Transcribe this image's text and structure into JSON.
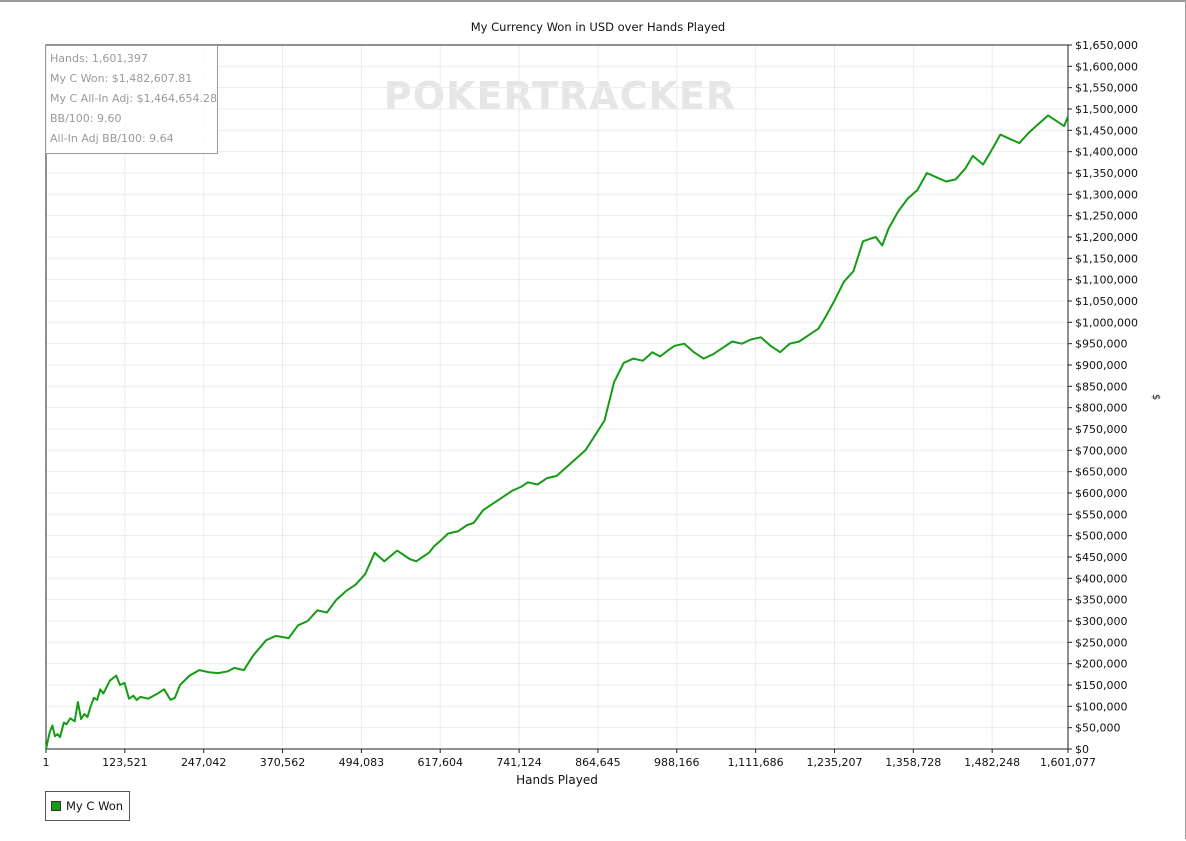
{
  "chart_data": {
    "type": "line",
    "title": "My Currency Won in USD over Hands Played",
    "xlabel": "Hands Played",
    "ylabel": "$",
    "watermark": "POKERTRACKER",
    "xlim": [
      1,
      1601077
    ],
    "ylim": [
      0,
      1650000
    ],
    "x_ticks": [
      1,
      123521,
      247042,
      370562,
      494083,
      617604,
      741124,
      864645,
      988166,
      1111686,
      1235207,
      1358728,
      1482248,
      1601077
    ],
    "x_tick_labels": [
      "1",
      "123,521",
      "247,042",
      "370,562",
      "494,083",
      "617,604",
      "741,124",
      "864,645",
      "988,166",
      "1,111,686",
      "1,235,207",
      "1,358,728",
      "1,482,248",
      "1,601,077"
    ],
    "y_ticks": [
      0,
      50000,
      100000,
      150000,
      200000,
      250000,
      300000,
      350000,
      400000,
      450000,
      500000,
      550000,
      600000,
      650000,
      700000,
      750000,
      800000,
      850000,
      900000,
      950000,
      1000000,
      1050000,
      1100000,
      1150000,
      1200000,
      1250000,
      1300000,
      1350000,
      1400000,
      1450000,
      1500000,
      1550000,
      1600000,
      1650000
    ],
    "y_tick_labels": [
      "$0",
      "$50,000",
      "$100,000",
      "$150,000",
      "$200,000",
      "$250,000",
      "$300,000",
      "$350,000",
      "$400,000",
      "$450,000",
      "$500,000",
      "$550,000",
      "$600,000",
      "$650,000",
      "$700,000",
      "$750,000",
      "$800,000",
      "$850,000",
      "$900,000",
      "$950,000",
      "$1,000,000",
      "$1,050,000",
      "$1,100,000",
      "$1,150,000",
      "$1,200,000",
      "$1,250,000",
      "$1,300,000",
      "$1,350,000",
      "$1,400,000",
      "$1,450,000",
      "$1,500,000",
      "$1,550,000",
      "$1,600,000",
      "$1,650,000"
    ],
    "grid": true,
    "legend_position": "bottom-left",
    "series": [
      {
        "name": "My C Won",
        "color": "#159c15",
        "x": [
          1,
          6000,
          10000,
          14000,
          18000,
          22000,
          28000,
          32000,
          38000,
          45000,
          50000,
          55000,
          60000,
          65000,
          70000,
          75000,
          80000,
          85000,
          90000,
          100000,
          110000,
          116000,
          123000,
          130000,
          137000,
          142000,
          148000,
          160000,
          175000,
          185000,
          195000,
          202000,
          210000,
          225000,
          240000,
          255000,
          270000,
          285000,
          295000,
          310000,
          325000,
          345000,
          360000,
          380000,
          395000,
          410000,
          425000,
          440000,
          455000,
          470000,
          485000,
          500000,
          515000,
          530000,
          550000,
          565000,
          570000,
          580000,
          590000,
          600000,
          608000,
          618000,
          630000,
          645000,
          660000,
          670000,
          685000,
          700000,
          715000,
          730000,
          745000,
          755000,
          770000,
          785000,
          800000,
          815000,
          830000,
          845000,
          860000,
          875000,
          890000,
          905000,
          920000,
          935000,
          950000,
          962000,
          975000,
          985000,
          1000000,
          1015000,
          1030000,
          1045000,
          1060000,
          1075000,
          1090000,
          1105000,
          1120000,
          1135000,
          1150000,
          1165000,
          1180000,
          1195000,
          1210000,
          1220000,
          1235000,
          1250000,
          1265000,
          1280000,
          1290000,
          1300000,
          1310000,
          1320000,
          1335000,
          1350000,
          1365000,
          1380000,
          1395000,
          1410000,
          1425000,
          1440000,
          1452000,
          1468000,
          1480000,
          1495000,
          1510000,
          1525000,
          1540000,
          1555000,
          1570000,
          1585000,
          1595000,
          1601077
        ],
        "y": [
          0,
          40000,
          55000,
          30000,
          35000,
          28000,
          62000,
          58000,
          72000,
          65000,
          110000,
          70000,
          82000,
          75000,
          100000,
          120000,
          115000,
          140000,
          130000,
          160000,
          172000,
          150000,
          155000,
          118000,
          125000,
          115000,
          122000,
          118000,
          130000,
          140000,
          115000,
          120000,
          150000,
          172000,
          185000,
          180000,
          178000,
          182000,
          190000,
          185000,
          220000,
          255000,
          265000,
          260000,
          290000,
          300000,
          325000,
          320000,
          350000,
          370000,
          385000,
          410000,
          460000,
          440000,
          465000,
          450000,
          445000,
          440000,
          450000,
          460000,
          475000,
          488000,
          505000,
          510000,
          525000,
          530000,
          560000,
          575000,
          590000,
          605000,
          615000,
          625000,
          620000,
          635000,
          640000,
          660000,
          680000,
          700000,
          735000,
          770000,
          860000,
          905000,
          915000,
          910000,
          930000,
          920000,
          935000,
          945000,
          950000,
          930000,
          915000,
          925000,
          940000,
          955000,
          950000,
          960000,
          965000,
          945000,
          930000,
          950000,
          955000,
          970000,
          985000,
          1010000,
          1050000,
          1095000,
          1120000,
          1190000,
          1195000,
          1200000,
          1180000,
          1220000,
          1260000,
          1290000,
          1310000,
          1350000,
          1340000,
          1330000,
          1335000,
          1360000,
          1390000,
          1370000,
          1400000,
          1440000,
          1430000,
          1420000,
          1445000,
          1465000,
          1485000,
          1470000,
          1460000,
          1482607
        ]
      }
    ]
  },
  "stats": {
    "hands": "Hands: 1,601,397",
    "won": "My C Won: $1,482,607.81",
    "allin_adj": "My C All-In Adj: $1,464,654.28",
    "bb100": "BB/100: 9.60",
    "allin_bb100": "All-In Adj BB/100: 9.64"
  },
  "legend": {
    "label": "My C Won"
  }
}
